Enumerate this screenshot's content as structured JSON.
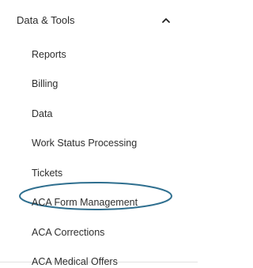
{
  "section": {
    "title": "Data & Tools",
    "toggle_icon": "chevron-up-icon"
  },
  "menu": {
    "items": [
      {
        "label": "Reports"
      },
      {
        "label": "Billing"
      },
      {
        "label": "Data"
      },
      {
        "label": "Work Status Processing"
      },
      {
        "label": "Tickets"
      },
      {
        "label": "ACA Form Management"
      },
      {
        "label": "ACA Corrections"
      },
      {
        "label": "ACA Medical Offers"
      }
    ]
  },
  "annotation": {
    "highlight_color": "#2f6f8f",
    "highlight_icon": "ellipse-highlight"
  }
}
